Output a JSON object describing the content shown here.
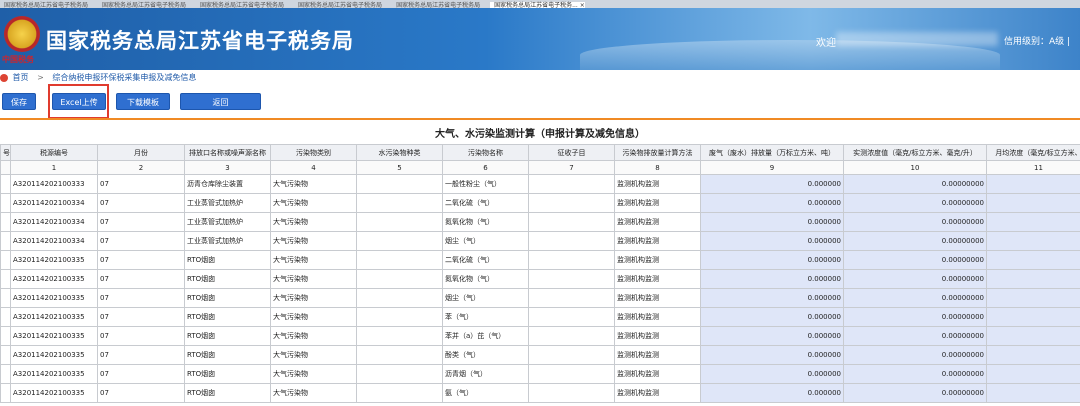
{
  "browser_tabs": [
    "国家税务总局江苏省电子税务局",
    "国家税务总局江苏省电子税务局",
    "国家税务总局江苏省电子税务局",
    "国家税务总局江苏省电子税务局",
    "国家税务总局江苏省电子税务局",
    "国家税务总局江苏省电子税务... ×"
  ],
  "header": {
    "title": "国家税务总局江苏省电子税务局",
    "emblem_text": "中国税务",
    "welcome": "欢迎",
    "credit": "信用级别：A级 |"
  },
  "breadcrumb": {
    "home": "首页",
    "sep": ">",
    "current": "综合纳税申报环保税采集申报及减免信息"
  },
  "toolbar": {
    "save": "保存",
    "excel": "Excel上传",
    "template": "下载模板",
    "back": "返回"
  },
  "table": {
    "title": "大气、水污染监测计算（申报计算及减免信息）",
    "headers": [
      "号",
      "税源编号",
      "月份",
      "排放口名称或噪声源名称",
      "污染物类别",
      "水污染物种类",
      "污染物名称",
      "征收子目",
      "污染物排放量计算方法",
      "废气（废水）排放量（万标立方米、吨）",
      "实测浓度值（毫克/标立方米、毫克/升）",
      "月均浓度（毫克/标立方米、"
    ],
    "col_numbers": [
      "",
      "1",
      "2",
      "3",
      "4",
      "5",
      "6",
      "7",
      "8",
      "9",
      "10",
      "11"
    ],
    "rows": [
      [
        "",
        "A320114202100333",
        "07",
        "沥青仓库除尘装置",
        "大气污染物",
        "",
        "一般性粉尘（气）",
        "",
        "监测机构监测",
        "0.000000",
        "0.00000000",
        ""
      ],
      [
        "",
        "A320114202100334",
        "07",
        "工业蒸管式加热炉",
        "大气污染物",
        "",
        "二氧化硫（气）",
        "",
        "监测机构监测",
        "0.000000",
        "0.00000000",
        ""
      ],
      [
        "",
        "A320114202100334",
        "07",
        "工业蒸管式加热炉",
        "大气污染物",
        "",
        "氮氧化物（气）",
        "",
        "监测机构监测",
        "0.000000",
        "0.00000000",
        ""
      ],
      [
        "",
        "A320114202100334",
        "07",
        "工业蒸管式加热炉",
        "大气污染物",
        "",
        "烟尘（气）",
        "",
        "监测机构监测",
        "0.000000",
        "0.00000000",
        ""
      ],
      [
        "",
        "A320114202100335",
        "07",
        "RTO烟囱",
        "大气污染物",
        "",
        "二氧化硫（气）",
        "",
        "监测机构监测",
        "0.000000",
        "0.00000000",
        ""
      ],
      [
        "",
        "A320114202100335",
        "07",
        "RTO烟囱",
        "大气污染物",
        "",
        "氮氧化物（气）",
        "",
        "监测机构监测",
        "0.000000",
        "0.00000000",
        ""
      ],
      [
        "",
        "A320114202100335",
        "07",
        "RTO烟囱",
        "大气污染物",
        "",
        "烟尘（气）",
        "",
        "监测机构监测",
        "0.000000",
        "0.00000000",
        ""
      ],
      [
        "",
        "A320114202100335",
        "07",
        "RTO烟囱",
        "大气污染物",
        "",
        "苯（气）",
        "",
        "监测机构监测",
        "0.000000",
        "0.00000000",
        ""
      ],
      [
        "",
        "A320114202100335",
        "07",
        "RTO烟囱",
        "大气污染物",
        "",
        "苯并（a）芘（气）",
        "",
        "监测机构监测",
        "0.000000",
        "0.00000000",
        ""
      ],
      [
        "",
        "A320114202100335",
        "07",
        "RTO烟囱",
        "大气污染物",
        "",
        "酚类（气）",
        "",
        "监测机构监测",
        "0.000000",
        "0.00000000",
        ""
      ],
      [
        "",
        "A320114202100335",
        "07",
        "RTO烟囱",
        "大气污染物",
        "",
        "沥青烟（气）",
        "",
        "监测机构监测",
        "0.000000",
        "0.00000000",
        ""
      ],
      [
        "",
        "A320114202100335",
        "07",
        "RTO烟囱",
        "大气污染物",
        "",
        "氨（气）",
        "",
        "监测机构监测",
        "0.000000",
        "0.00000000",
        ""
      ]
    ]
  }
}
